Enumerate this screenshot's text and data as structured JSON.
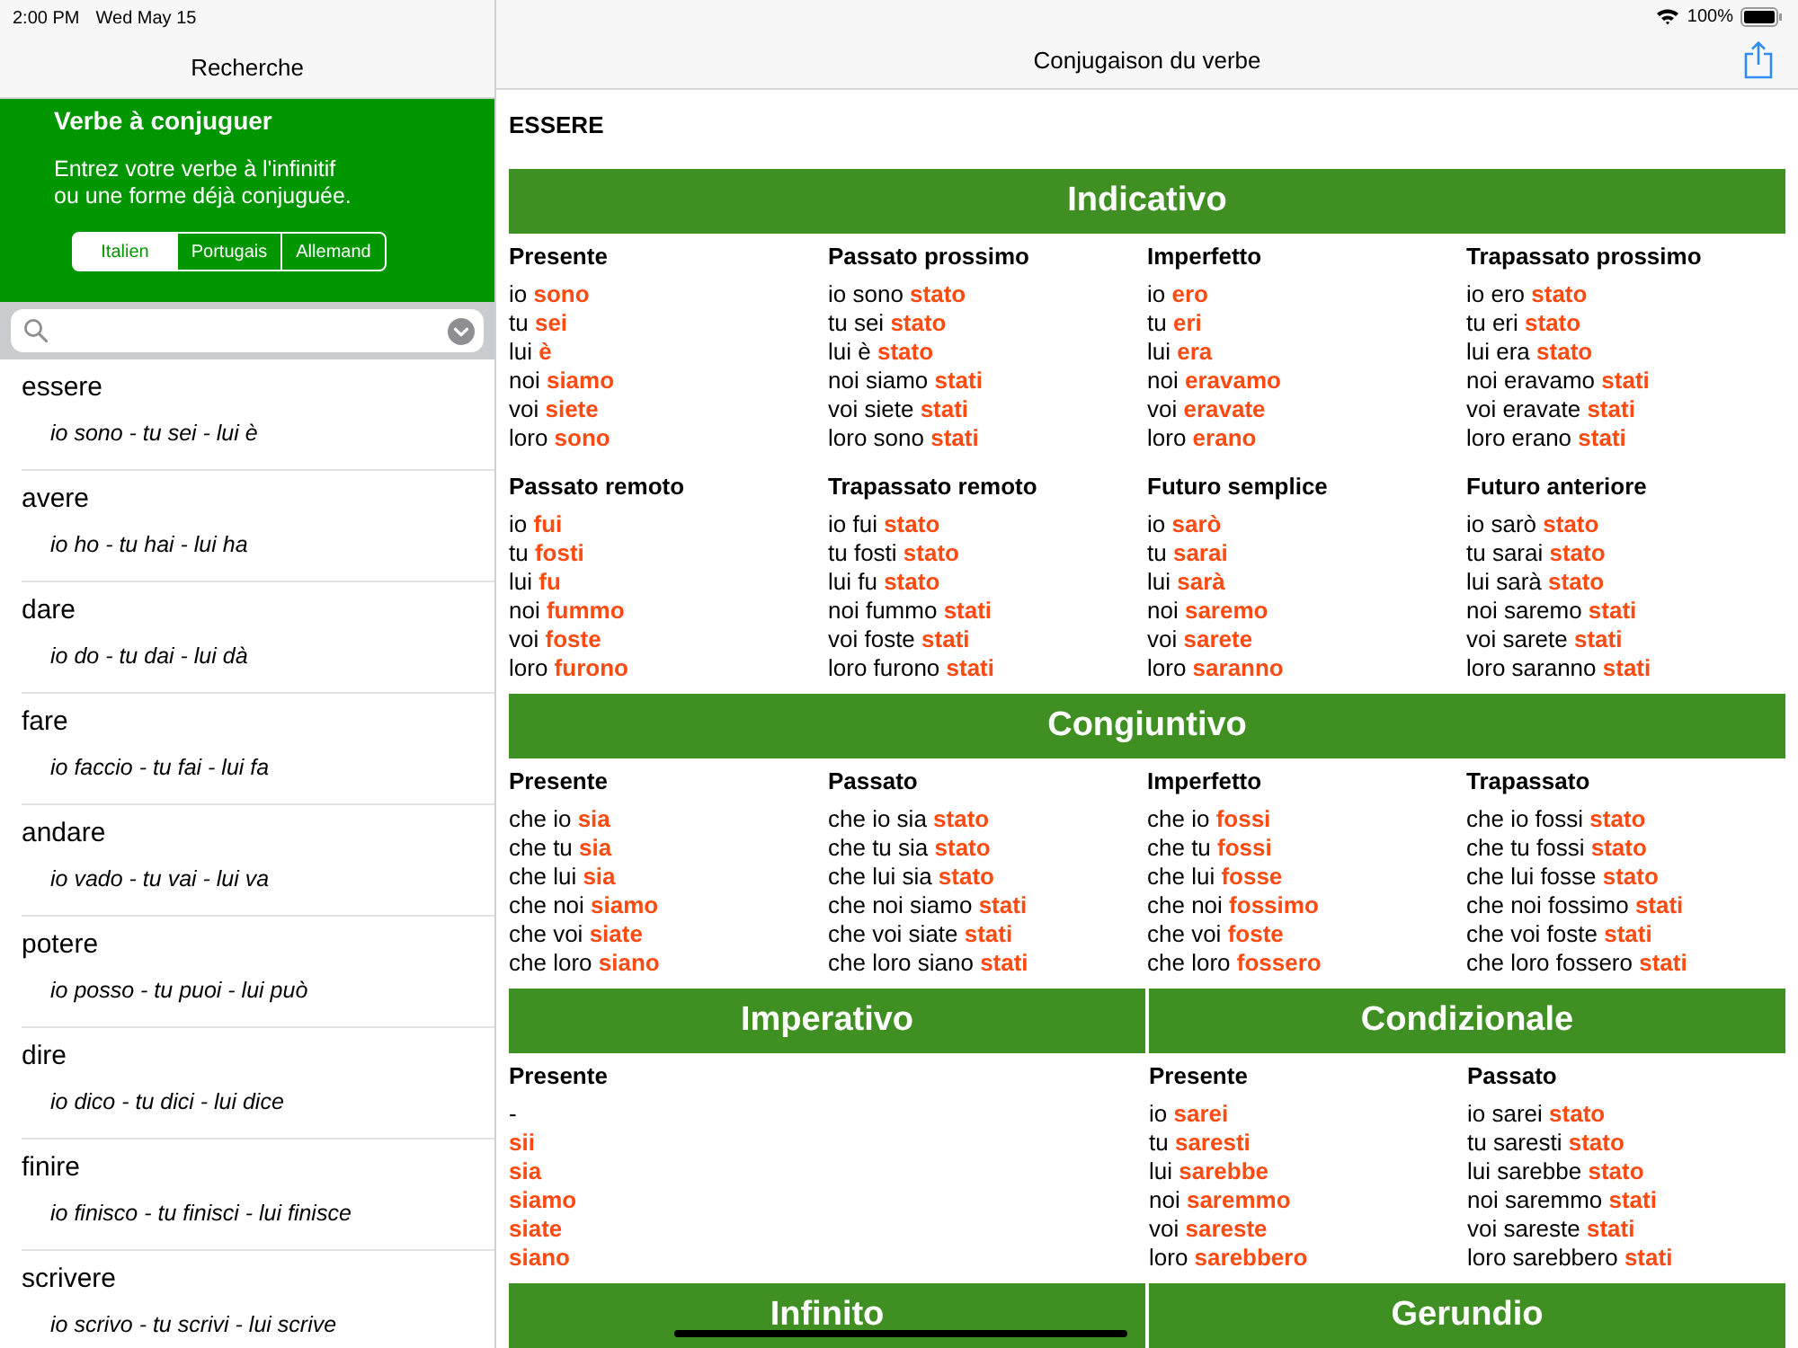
{
  "status_bar": {
    "time": "2:00 PM",
    "date": "Wed May 15",
    "battery": "100%"
  },
  "sidebar": {
    "title": "Recherche",
    "panel": {
      "heading": "Verbe à conjuguer",
      "text": "Entrez votre verbe à l'infinitif\nou une forme déjà conjuguée.",
      "languages": [
        {
          "label": "Italien",
          "selected": true
        },
        {
          "label": "Portugais",
          "selected": false
        },
        {
          "label": "Allemand",
          "selected": false
        }
      ]
    },
    "verbs": [
      {
        "name": "essere",
        "forms": "io sono - tu sei - lui è"
      },
      {
        "name": "avere",
        "forms": "io ho - tu hai - lui ha"
      },
      {
        "name": "dare",
        "forms": "io do - tu dai - lui dà"
      },
      {
        "name": "fare",
        "forms": "io faccio - tu fai - lui fa"
      },
      {
        "name": "andare",
        "forms": "io vado - tu vai - lui va"
      },
      {
        "name": "potere",
        "forms": "io posso - tu puoi - lui può"
      },
      {
        "name": "dire",
        "forms": "io dico - tu dici - lui dice"
      },
      {
        "name": "finire",
        "forms": "io finisco - tu finisci - lui finisce"
      },
      {
        "name": "scrivere",
        "forms": "io scrivo - tu scrivi - lui scrive"
      }
    ]
  },
  "main": {
    "title": "Conjugaison du verbe",
    "verb": "ESSERE",
    "bands": [
      {
        "moods": [
          {
            "title": "Indicativo",
            "tense_rows": [
              [
                {
                  "name": "Presente",
                  "lines": [
                    "io **sono**",
                    "tu **sei**",
                    "lui **è**",
                    "noi **siamo**",
                    "voi **siete**",
                    "loro **sono**"
                  ]
                },
                {
                  "name": "Passato prossimo",
                  "lines": [
                    "io sono **stato**",
                    "tu sei **stato**",
                    "lui è **stato**",
                    "noi siamo **stati**",
                    "voi siete **stati**",
                    "loro sono **stati**"
                  ]
                },
                {
                  "name": "Imperfetto",
                  "lines": [
                    "io **ero**",
                    "tu **eri**",
                    "lui **era**",
                    "noi **eravamo**",
                    "voi **eravate**",
                    "loro **erano**"
                  ]
                },
                {
                  "name": "Trapassato prossimo",
                  "lines": [
                    "io ero **stato**",
                    "tu eri **stato**",
                    "lui era **stato**",
                    "noi eravamo **stati**",
                    "voi eravate **stati**",
                    "loro erano **stati**"
                  ]
                }
              ],
              [
                {
                  "name": "Passato remoto",
                  "lines": [
                    "io **fui**",
                    "tu **fosti**",
                    "lui **fu**",
                    "noi **fummo**",
                    "voi **foste**",
                    "loro **furono**"
                  ]
                },
                {
                  "name": "Trapassato remoto",
                  "lines": [
                    "io fui **stato**",
                    "tu fosti **stato**",
                    "lui fu **stato**",
                    "noi fummo **stati**",
                    "voi foste **stati**",
                    "loro furono **stati**"
                  ]
                },
                {
                  "name": "Futuro semplice",
                  "lines": [
                    "io **sarò**",
                    "tu **sarai**",
                    "lui **sarà**",
                    "noi **saremo**",
                    "voi **sarete**",
                    "loro **saranno**"
                  ]
                },
                {
                  "name": "Futuro anteriore",
                  "lines": [
                    "io sarò **stato**",
                    "tu sarai **stato**",
                    "lui sarà **stato**",
                    "noi saremo **stati**",
                    "voi sarete **stati**",
                    "loro saranno **stati**"
                  ]
                }
              ]
            ]
          }
        ]
      },
      {
        "moods": [
          {
            "title": "Congiuntivo",
            "tense_rows": [
              [
                {
                  "name": "Presente",
                  "lines": [
                    "che io **sia**",
                    "che tu **sia**",
                    "che lui **sia**",
                    "che noi **siamo**",
                    "che voi **siate**",
                    "che loro **siano**"
                  ]
                },
                {
                  "name": "Passato",
                  "lines": [
                    "che io sia **stato**",
                    "che tu sia **stato**",
                    "che lui sia **stato**",
                    "che noi siamo **stati**",
                    "che voi siate **stati**",
                    "che loro siano **stati**"
                  ]
                },
                {
                  "name": "Imperfetto",
                  "lines": [
                    "che io **fossi**",
                    "che tu **fossi**",
                    "che lui **fosse**",
                    "che noi **fossimo**",
                    "che voi **foste**",
                    "che loro **fossero**"
                  ]
                },
                {
                  "name": "Trapassato",
                  "lines": [
                    "che io fossi **stato**",
                    "che tu fossi **stato**",
                    "che lui fosse **stato**",
                    "che noi fossimo **stati**",
                    "che voi foste **stati**",
                    "che loro fossero **stati**"
                  ]
                }
              ]
            ]
          }
        ]
      },
      {
        "moods": [
          {
            "title": "Imperativo",
            "tense_rows": [
              [
                {
                  "name": "Presente",
                  "lines": [
                    "-",
                    "**sii**",
                    "**sia**",
                    "**siamo**",
                    "**siate**",
                    "**siano**"
                  ]
                }
              ]
            ]
          },
          {
            "title": "Condizionale",
            "tense_rows": [
              [
                {
                  "name": "Presente",
                  "lines": [
                    "io **sarei**",
                    "tu **saresti**",
                    "lui **sarebbe**",
                    "noi **saremmo**",
                    "voi **sareste**",
                    "loro **sarebbero**"
                  ]
                },
                {
                  "name": "Passato",
                  "lines": [
                    "io sarei **stato**",
                    "tu saresti **stato**",
                    "lui sarebbe **stato**",
                    "noi saremmo **stati**",
                    "voi sareste **stati**",
                    "loro sarebbero **stati**"
                  ]
                }
              ]
            ]
          }
        ]
      },
      {
        "moods": [
          {
            "title": "Infinito"
          },
          {
            "title": "Gerundio"
          }
        ]
      }
    ]
  }
}
